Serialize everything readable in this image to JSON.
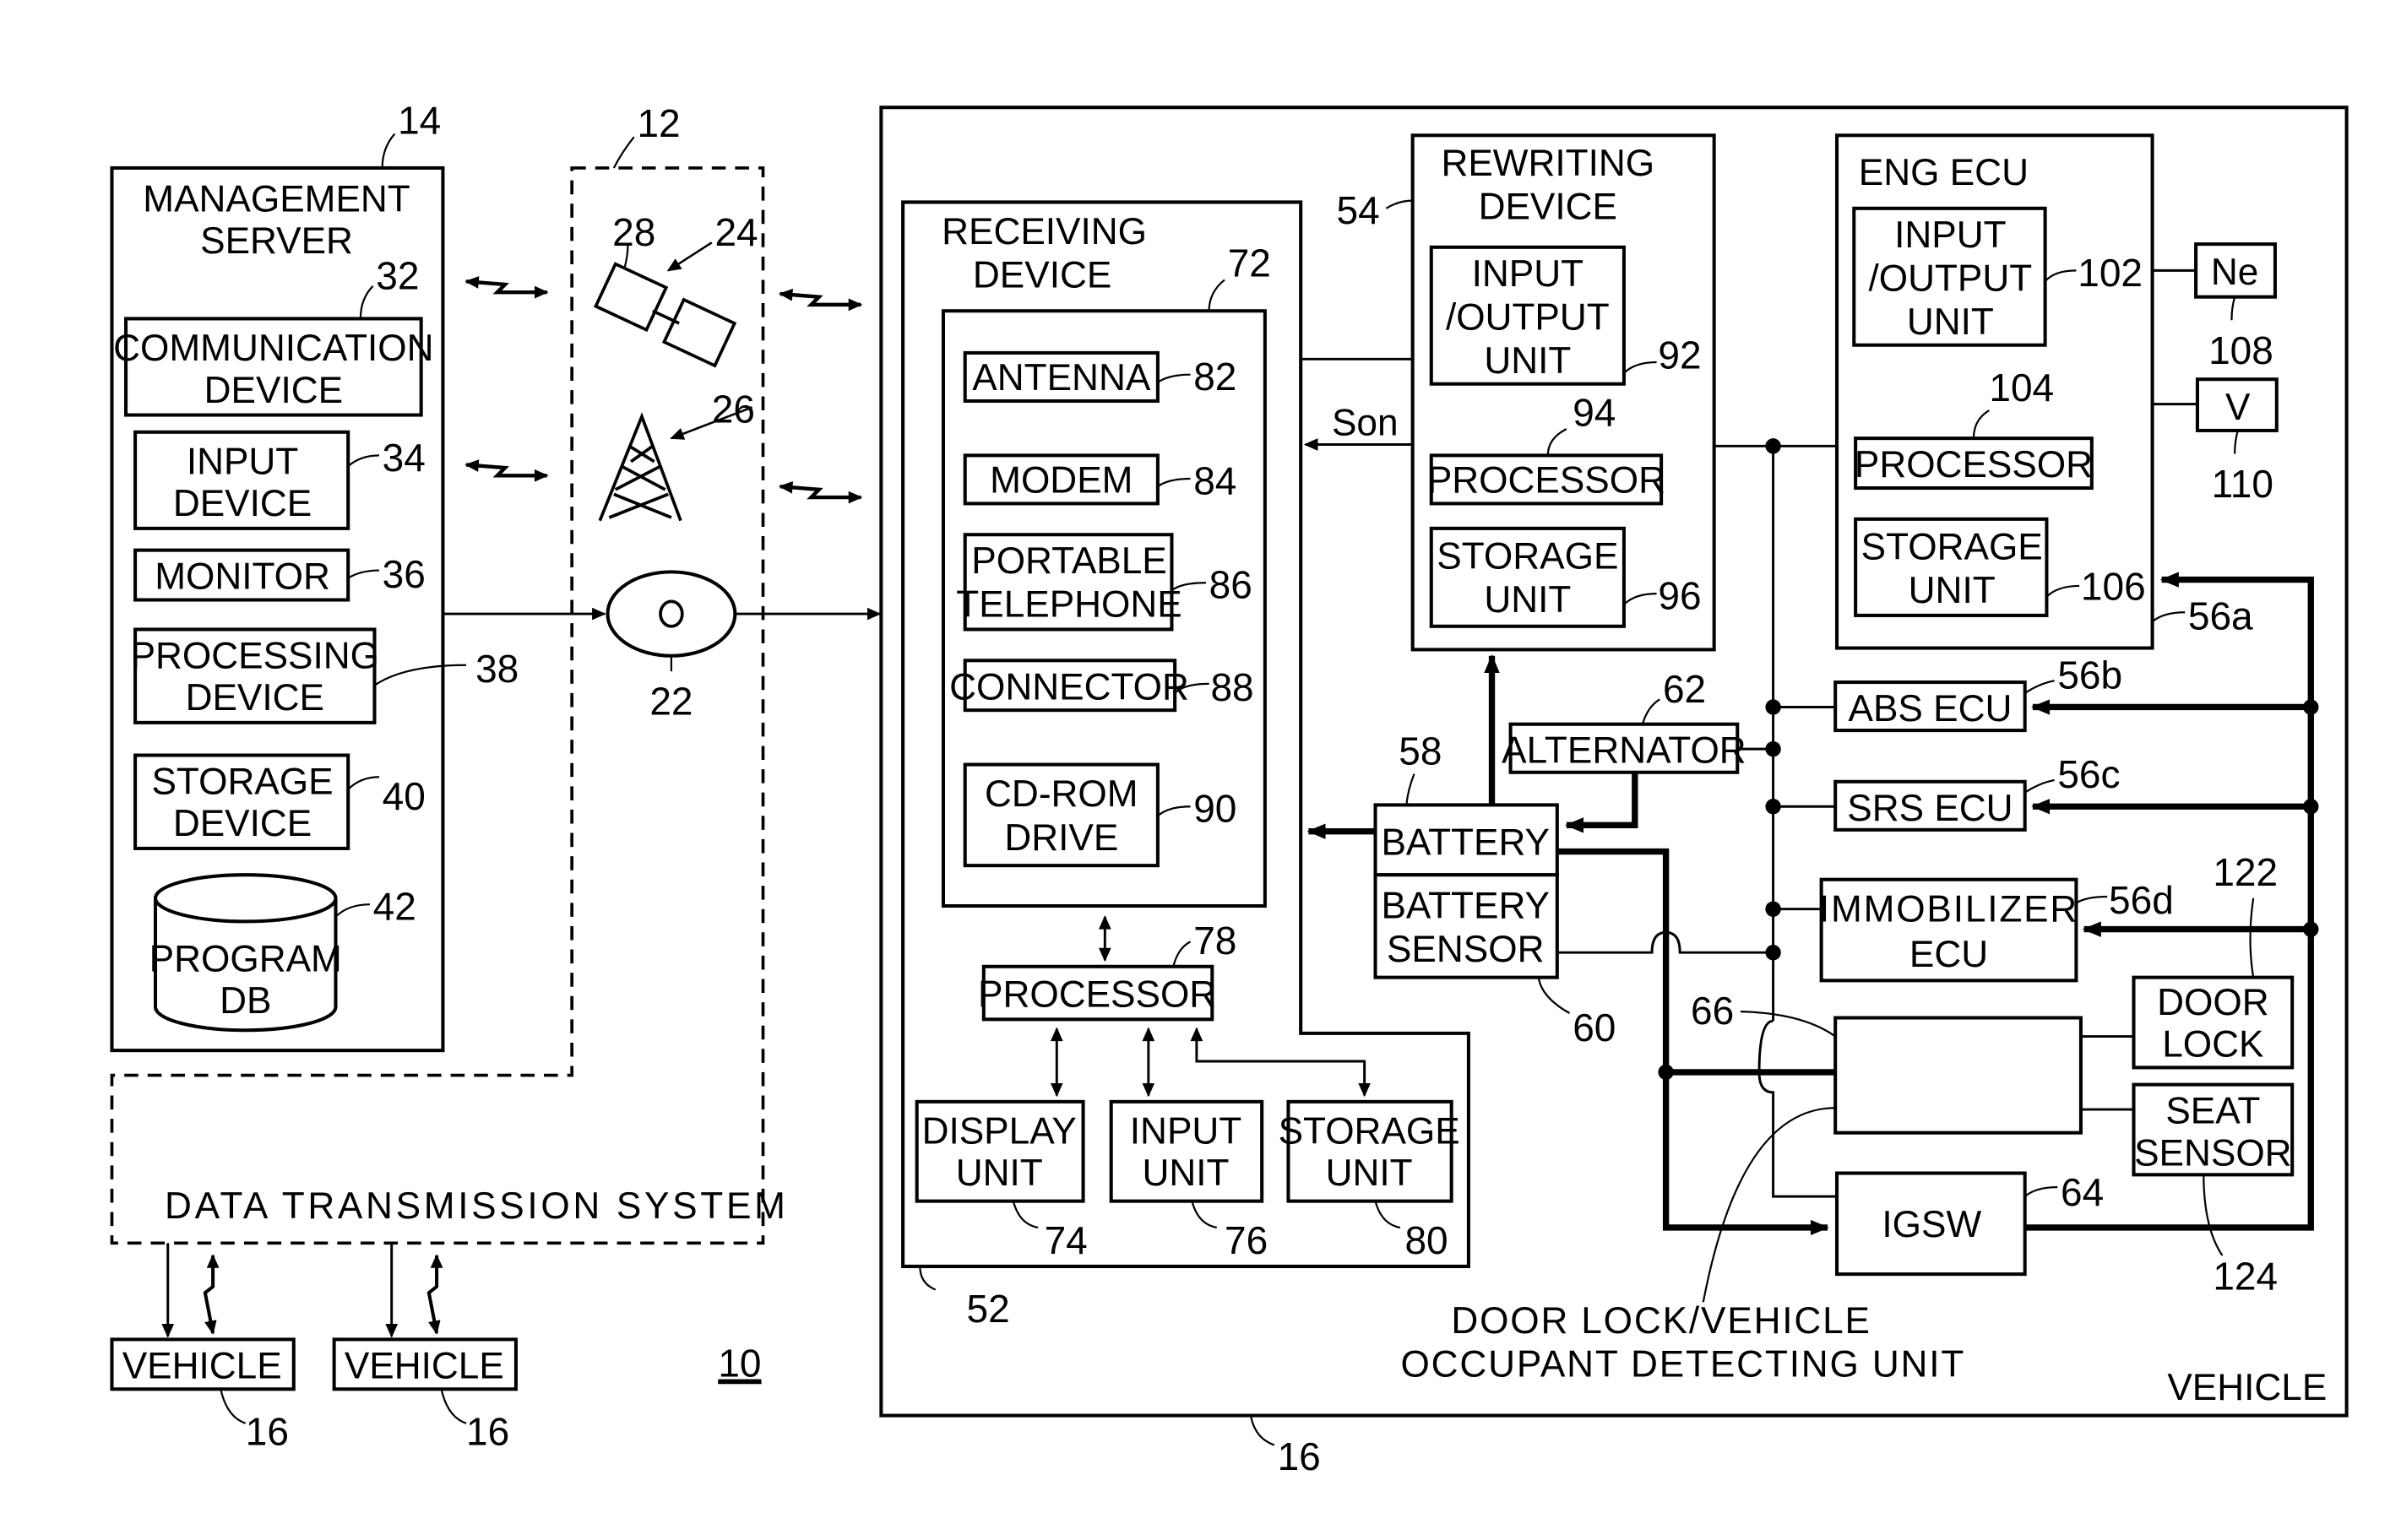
{
  "figure_ref": "10",
  "system": {
    "label": "DATA TRANSMISSION SYSTEM",
    "ref": "12"
  },
  "management_server": {
    "title_line1": "MANAGEMENT",
    "title_line2": "SERVER",
    "ref": "14",
    "communication_device": {
      "line1": "COMMUNICATION",
      "line2": "DEVICE",
      "ref": "32"
    },
    "input_device": {
      "line1": "INPUT",
      "line2": "DEVICE",
      "ref": "34"
    },
    "monitor": {
      "line1": "MONITOR",
      "ref": "36"
    },
    "processing_device": {
      "line1": "PROCESSING",
      "line2": "DEVICE",
      "ref": "38"
    },
    "storage_device": {
      "line1": "STORAGE",
      "line2": "DEVICE",
      "ref": "40"
    },
    "program_db": {
      "line1": "PROGRAM",
      "line2": "DB",
      "ref": "42"
    }
  },
  "network": {
    "satellite_ref": "24",
    "satellite_body_ref": "28",
    "tower_ref": "26",
    "disc_ref": "22"
  },
  "small_vehicles": [
    {
      "label": "VEHICLE",
      "ref": "16"
    },
    {
      "label": "VEHICLE",
      "ref": "16"
    }
  ],
  "vehicle": {
    "label": "VEHICLE",
    "ref": "16",
    "receiving_device": {
      "title_line1": "RECEIVING",
      "title_line2": "DEVICE",
      "ref": "52",
      "inner_ref": "72",
      "antenna": {
        "label": "ANTENNA",
        "ref": "82"
      },
      "modem": {
        "label": "MODEM",
        "ref": "84"
      },
      "portable_telephone": {
        "line1": "PORTABLE",
        "line2": "TELEPHONE",
        "ref": "86"
      },
      "connector": {
        "label": "CONNECTOR",
        "ref": "88"
      },
      "cdrom": {
        "line1": "CD-ROM",
        "line2": "DRIVE",
        "ref": "90"
      },
      "processor": {
        "label": "PROCESSOR",
        "ref": "78"
      },
      "display_unit": {
        "line1": "DISPLAY",
        "line2": "UNIT",
        "ref": "74"
      },
      "input_unit": {
        "line1": "INPUT",
        "line2": "UNIT",
        "ref": "76"
      },
      "storage_unit": {
        "line1": "STORAGE",
        "line2": "UNIT",
        "ref": "80"
      }
    },
    "signal_label": "Son",
    "rewriting_device": {
      "title_line1": "REWRITING",
      "title_line2": "DEVICE",
      "ref": "54",
      "io_unit": {
        "line1": "INPUT",
        "line2": "/OUTPUT",
        "line3": "UNIT",
        "ref": "92"
      },
      "processor": {
        "label": "PROCESSOR",
        "ref": "94"
      },
      "storage_unit": {
        "line1": "STORAGE",
        "line2": "UNIT",
        "ref": "96"
      }
    },
    "eng_ecu": {
      "title": "ENG ECU",
      "ref": "56a",
      "io_unit": {
        "line1": "INPUT",
        "line2": "/OUTPUT",
        "line3": "UNIT",
        "ref": "102"
      },
      "processor": {
        "label": "PROCESSOR",
        "ref": "104"
      },
      "storage_unit": {
        "line1": "STORAGE",
        "line2": "UNIT",
        "ref": "106"
      },
      "ne_sensor": {
        "label": "Ne",
        "ref": "108"
      },
      "v_sensor": {
        "label": "V",
        "ref": "110"
      }
    },
    "abs_ecu": {
      "label": "ABS ECU",
      "ref": "56b"
    },
    "srs_ecu": {
      "label": "SRS ECU",
      "ref": "56c"
    },
    "immobilizer_ecu": {
      "line1": "IMMOBILIZER",
      "line2": "ECU",
      "ref": "56d"
    },
    "alternator": {
      "label": "ALTERNATOR",
      "ref": "62"
    },
    "battery": {
      "label": "BATTERY",
      "ref": "58"
    },
    "battery_sensor": {
      "line1": "BATTERY",
      "line2": "SENSOR",
      "ref": "60"
    },
    "door_lock_unit": {
      "line1": "DOOR LOCK/VEHICLE",
      "line2": "OCCUPANT DETECTING UNIT",
      "ref": "66"
    },
    "door_lock": {
      "line1": "DOOR",
      "line2": "LOCK",
      "ref": "122"
    },
    "seat_sensor": {
      "line1": "SEAT",
      "line2": "SENSOR",
      "ref": "124"
    },
    "igsw": {
      "label": "IGSW",
      "ref": "64"
    }
  }
}
